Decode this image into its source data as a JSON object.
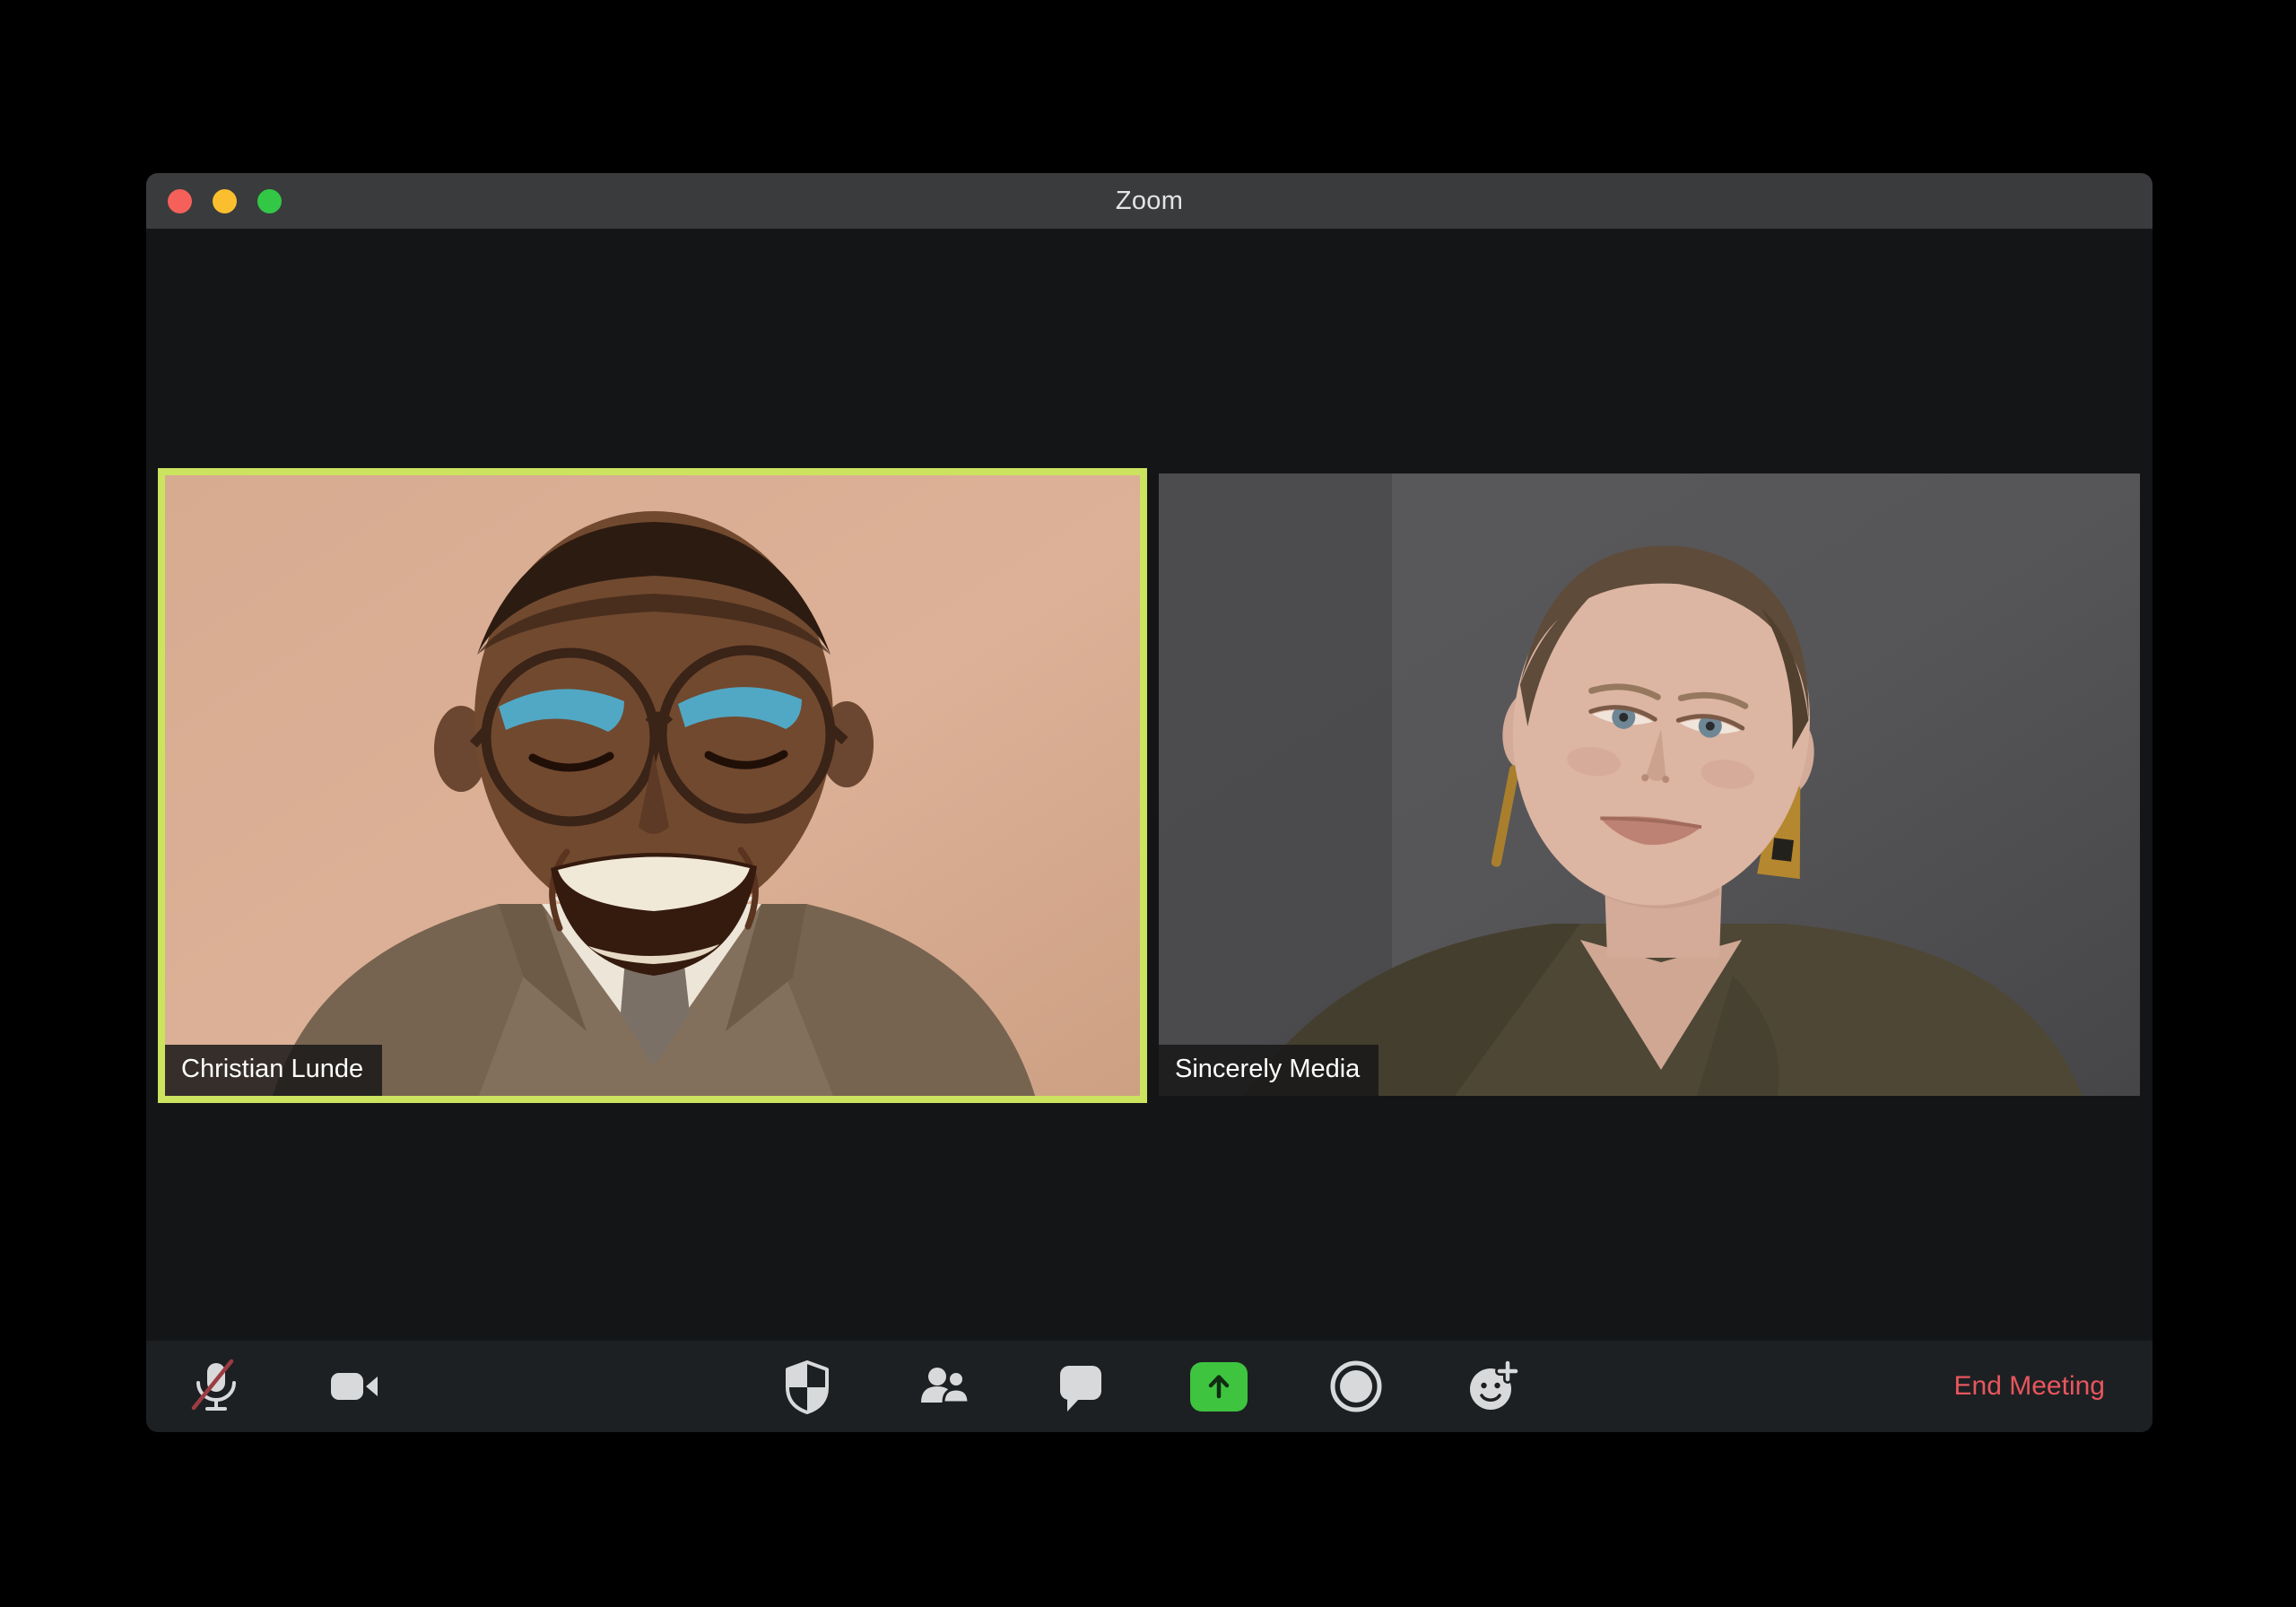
{
  "window": {
    "title": "Zoom",
    "titlebar_buttons": [
      {
        "name": "close",
        "color": "#f6605a"
      },
      {
        "name": "minimize",
        "color": "#fbbe2e"
      },
      {
        "name": "zoom-fullscreen",
        "color": "#32c846"
      }
    ]
  },
  "participants": [
    {
      "name": "Christian Lunde",
      "active_speaker": true,
      "tile_background": "peach-tan wall, man with round glasses smiling, tweed jacket, white shirt, tie"
    },
    {
      "name": "Sincerely Media",
      "active_speaker": false,
      "tile_background": "dark gray wall, woman with short hair, olive top, amber earrings"
    }
  ],
  "toolbar": {
    "items": [
      {
        "name": "mute",
        "icon": "mic-muted-icon",
        "state": "muted"
      },
      {
        "name": "video",
        "icon": "video-camera-icon",
        "state": "on"
      },
      {
        "name": "security",
        "icon": "security-shield-icon"
      },
      {
        "name": "participants",
        "icon": "participants-icon"
      },
      {
        "name": "chat",
        "icon": "chat-bubble-icon"
      },
      {
        "name": "share-screen",
        "icon": "share-screen-up-arrow-icon",
        "highlight": "#3ec43f"
      },
      {
        "name": "record",
        "icon": "record-circle-icon"
      },
      {
        "name": "reactions",
        "icon": "smiley-plus-icon"
      }
    ],
    "end_meeting_label": "End Meeting"
  },
  "colors": {
    "desktop_background": "#000000",
    "window_body": "#141517",
    "titlebar": "#3a3b3d",
    "toolbar": "#1d2022",
    "active_speaker_border": "#cbe35f",
    "icon_gray": "#d8d9da",
    "share_green": "#3ec43f",
    "end_meeting_red": "#e8565e",
    "mute_slash_red": "#9c3c42",
    "name_badge_bg": "rgba(24,24,24,0.85)"
  }
}
